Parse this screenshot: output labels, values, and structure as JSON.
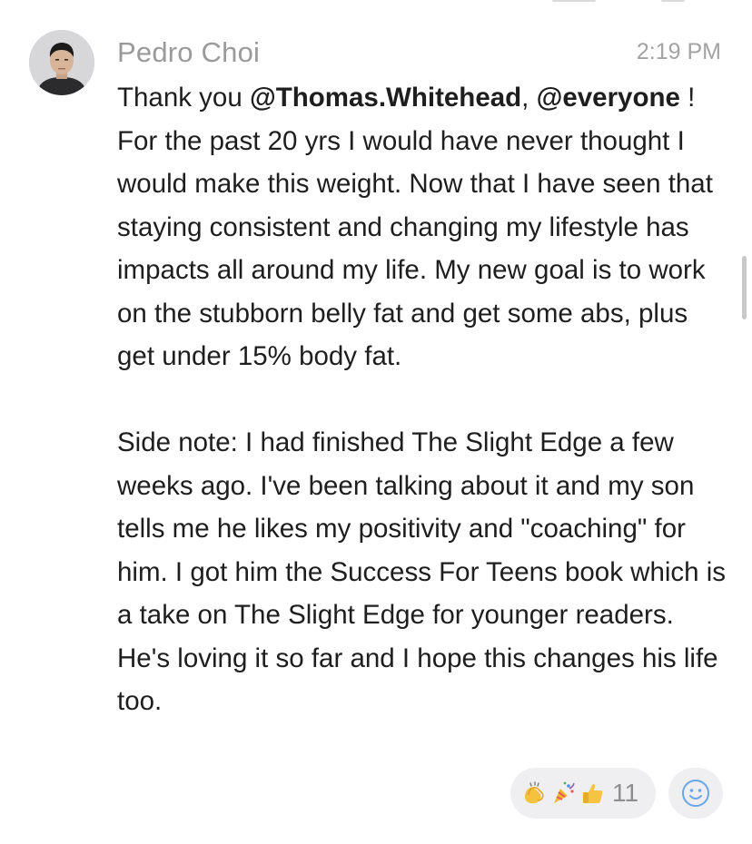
{
  "message": {
    "sender": "Pedro Choi",
    "timestamp": "2:19 PM",
    "paragraph1": {
      "text_before": "Thank you ",
      "mention1": "@Thomas.Whitehead",
      "separator": ", ",
      "mention2": "@everyone",
      "text_after": " !  For the past 20 yrs I would have never thought I would make this weight. Now that I have seen that staying consistent and changing my lifestyle has impacts all around my life. My new goal is to work on the stubborn belly fat and get some abs, plus get under 15% body fat."
    },
    "paragraph2": "Side note: I had finished The Slight Edge a few weeks ago. I've been talking about it and my son tells me he likes my positivity and \"coaching\" for him. I got him the Success For Teens book which is a take on The Slight Edge for younger readers. He's loving it so far and I hope this changes his life too."
  },
  "reactions": {
    "icons": [
      "clapping-hands-emoji",
      "party-popper-emoji",
      "thumbs-up-emoji"
    ],
    "count": "11"
  },
  "add_reaction": {
    "icon": "smiley-face-icon"
  },
  "colors": {
    "sender": "#9a9a9a",
    "timestamp": "#a3a3a3",
    "text": "#1e1e1e",
    "pill": "#efeff1",
    "smiley": "#6aa6e8"
  }
}
